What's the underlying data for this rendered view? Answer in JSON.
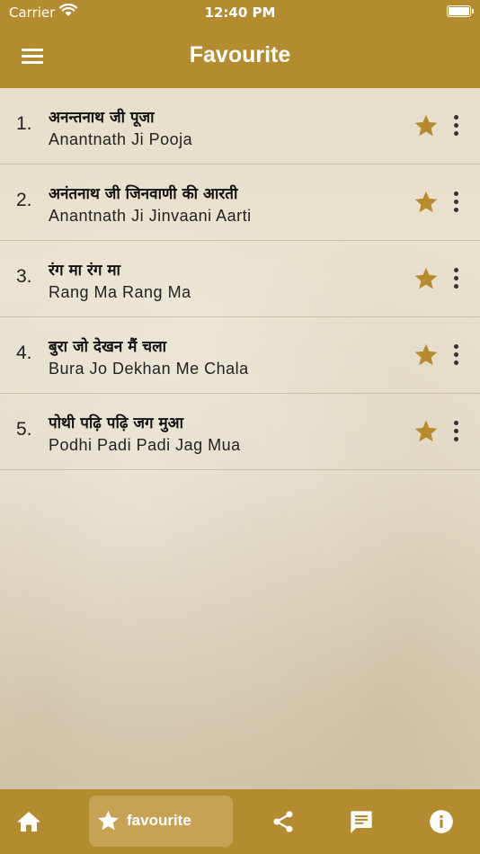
{
  "status_bar": {
    "carrier": "Carrier",
    "time": "12:40 PM"
  },
  "header": {
    "title": "Favourite"
  },
  "favourites": [
    {
      "number": "1.",
      "hindi": "अनन्तनाथ जी पूजा",
      "english": "Anantnath Ji Pooja"
    },
    {
      "number": "2.",
      "hindi": "अनंतनाथ जी जिनवाणी की आरती",
      "english": "Anantnath Ji Jinvaani Aarti"
    },
    {
      "number": "3.",
      "hindi": "रंग मा रंग मा",
      "english": "Rang Ma Rang Ma"
    },
    {
      "number": "4.",
      "hindi": "बुरा जो देखन मैं चला",
      "english": "Bura Jo Dekhan Me Chala"
    },
    {
      "number": "5.",
      "hindi": "पोथी पढ़ि पढ़ि जग मुआ",
      "english": "Podhi Padi Padi Jag Mua"
    }
  ],
  "tabbar": {
    "home_icon": "home-icon",
    "favourite_label": "favourite",
    "share_icon": "share-icon",
    "message_icon": "message-icon",
    "info_icon": "info-icon"
  },
  "colors": {
    "header": "#b58b2f",
    "star": "#b88a2c",
    "active_tab": "#c7a253"
  }
}
